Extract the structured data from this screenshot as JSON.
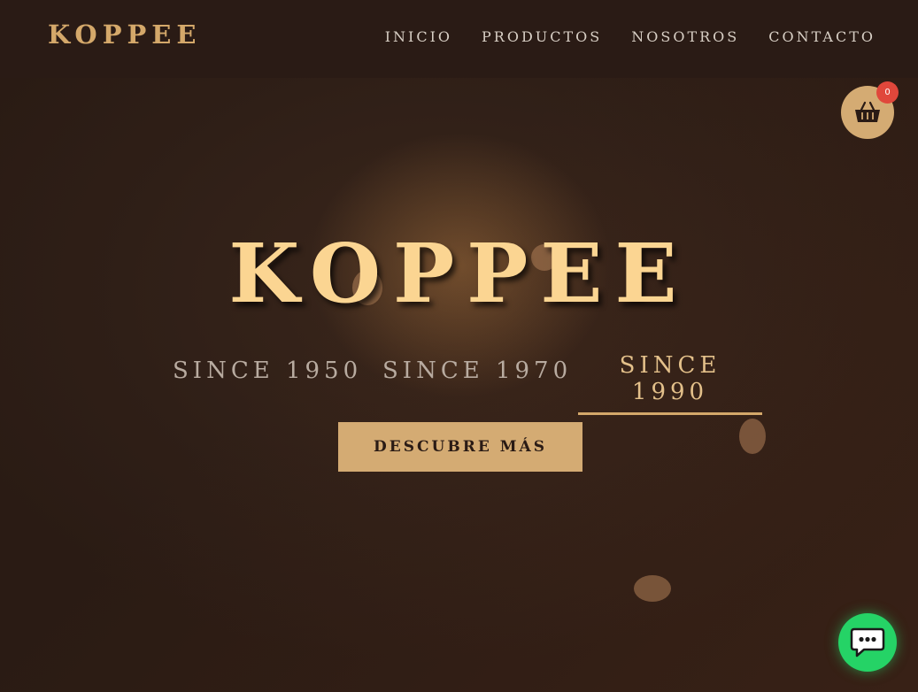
{
  "header": {
    "brand": "KOPPEE",
    "nav": [
      {
        "label": "INICIO"
      },
      {
        "label": "PRODUCTOS"
      },
      {
        "label": "NOSOTROS"
      },
      {
        "label": "CONTACTO"
      }
    ]
  },
  "hero": {
    "title": "KOPPEE",
    "tabs": [
      {
        "label": "SINCE 1950"
      },
      {
        "label": "SINCE 1970"
      },
      {
        "label": "SINCE 1990",
        "active": true
      }
    ],
    "cta_label": "DESCUBRE MÁS"
  },
  "cart": {
    "icon": "shopping-basket-icon",
    "count": "0"
  },
  "chat": {
    "icon": "chat-bubble-icon"
  },
  "colors": {
    "brand_gold": "#d4a86a",
    "hero_title": "#fbd592",
    "cart_badge": "#e0473b",
    "chat_green": "#25d366",
    "background": "#2e1d16"
  }
}
